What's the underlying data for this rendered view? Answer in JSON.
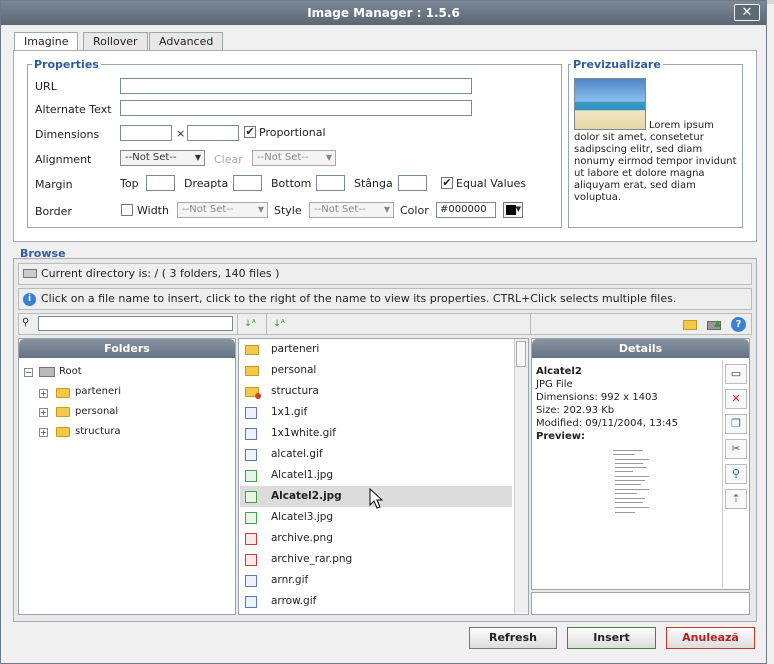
{
  "window": {
    "title": "Image Manager : 1.5.6",
    "close_label": "✕"
  },
  "tabs": [
    "Imagine",
    "Rollover",
    "Advanced"
  ],
  "properties": {
    "legend": "Properties",
    "url_label": "URL",
    "alt_label": "Alternate Text",
    "dimensions_label": "Dimensions",
    "times": "×",
    "proportional_label": "Proportional",
    "alignment_label": "Alignment",
    "alignment_value": "--Not Set--",
    "clear_label": "Clear",
    "clear_value": "--Not Set--",
    "margin_label": "Margin",
    "top_label": "Top",
    "right_label": "Dreapta",
    "bottom_label": "Bottom",
    "left_label": "Stânga",
    "equal_values_label": "Equal Values",
    "border_label": "Border",
    "width_label": "Width",
    "width_value": "--Not Set--",
    "style_label": "Style",
    "style_value": "--Not Set--",
    "color_label": "Color",
    "color_value": "#000000"
  },
  "preview": {
    "legend": "Previzualizare",
    "text": "Lorem ipsum dolor sit amet, consetetur sadipscing elitr, sed diam nonumy eirmod tempor invidunt ut labore et dolore magna aliquyam erat, sed diam voluptua."
  },
  "browse": {
    "legend": "Browse",
    "current_dir": "Current directory is: / ( 3 folders, 140 files )",
    "info": "Click on a file name to insert, click to the right of the name to view its properties. CTRL+Click selects multiple files.",
    "search_value": ""
  },
  "folders": {
    "header": "Folders",
    "root": "Root",
    "items": [
      "parteneri",
      "personal",
      "structura"
    ]
  },
  "files": [
    {
      "name": "parteneri",
      "icon": "folder-icon"
    },
    {
      "name": "personal",
      "icon": "folder-icon"
    },
    {
      "name": "structura",
      "icon": "locked-folder-icon"
    },
    {
      "name": "1x1.gif",
      "icon": "gif-icon"
    },
    {
      "name": "1x1white.gif",
      "icon": "gif-icon"
    },
    {
      "name": "alcatel.gif",
      "icon": "gif-icon"
    },
    {
      "name": "Alcatel1.jpg",
      "icon": "jpg-icon"
    },
    {
      "name": "Alcatel2.jpg",
      "icon": "jpg-icon",
      "selected": true
    },
    {
      "name": "Alcatel3.jpg",
      "icon": "jpg-icon"
    },
    {
      "name": "archive.png",
      "icon": "png-icon"
    },
    {
      "name": "archive_rar.png",
      "icon": "png-icon"
    },
    {
      "name": "arnr.gif",
      "icon": "gif-icon"
    },
    {
      "name": "arrow.gif",
      "icon": "gif-icon"
    }
  ],
  "details": {
    "header": "Details",
    "name": "Alcatel2",
    "type": "JPG File",
    "dimensions": "Dimensions: 992 x 1403",
    "size": "Size: 202.93 Kb",
    "modified": "Modified: 09/11/2004, 13:45",
    "preview_label": "Preview:"
  },
  "buttons": {
    "refresh": "Refresh",
    "insert": "Insert",
    "cancel": "Anulează"
  }
}
